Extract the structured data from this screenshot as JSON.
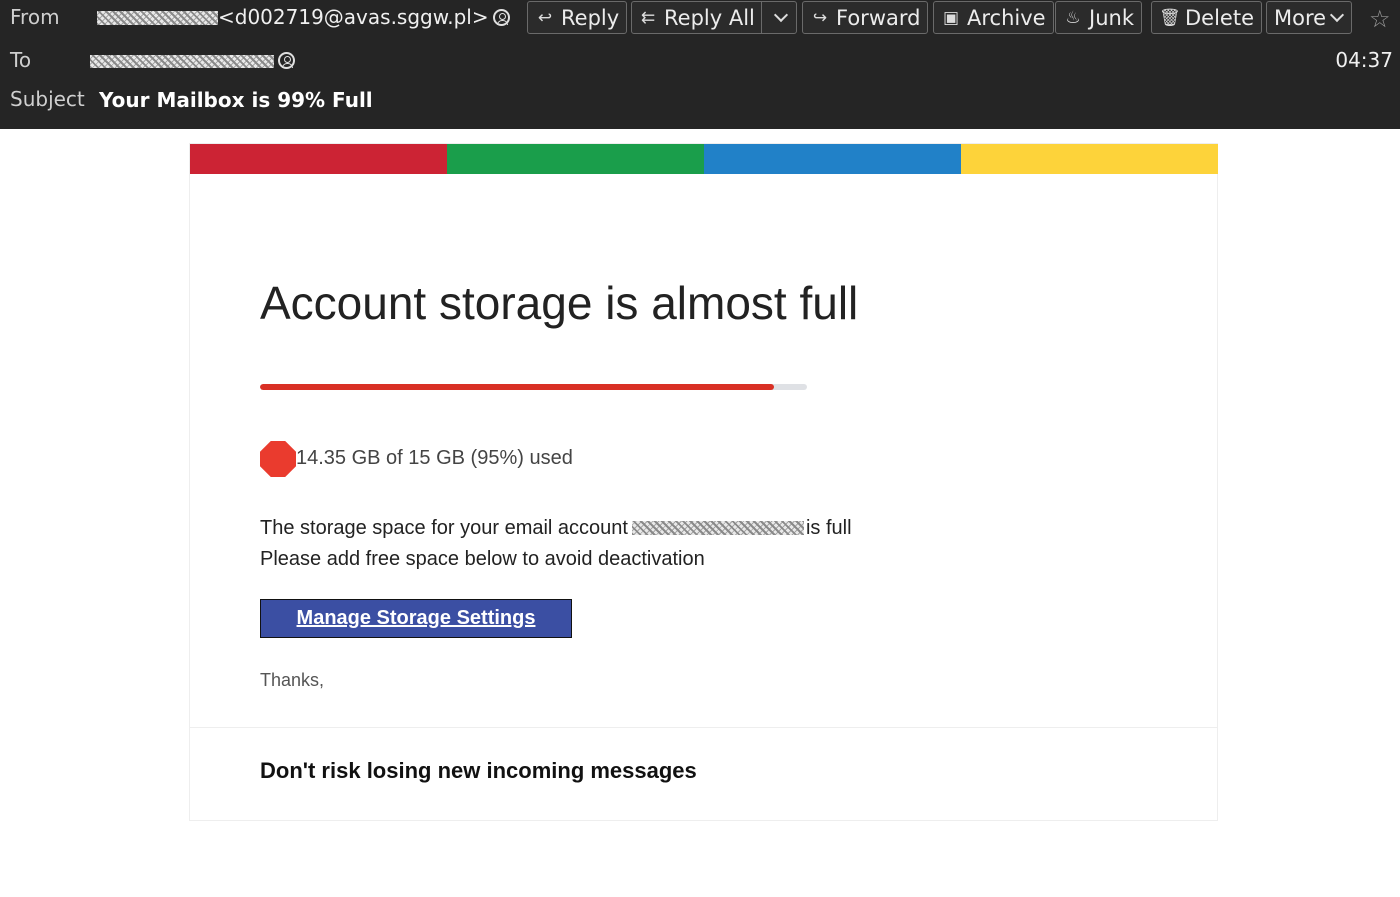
{
  "header": {
    "from_label": "From",
    "from_address": "<d002719@avas.sggw.pl>",
    "to_label": "To",
    "subject_label": "Subject",
    "subject": "Your Mailbox is 99% Full",
    "time": "04:37"
  },
  "toolbar": {
    "reply": "Reply",
    "reply_all": "Reply All",
    "forward": "Forward",
    "archive": "Archive",
    "junk": "Junk",
    "delete": "Delete",
    "more": "More"
  },
  "email": {
    "brand_colors": [
      "#cc2334",
      "#1a9e4b",
      "#2181c8",
      "#fdd33a"
    ],
    "title": "Account storage is almost full",
    "progress_percent": 94,
    "progress_color": "#d93025",
    "usage_text": "14.35 GB of 15 GB (95%) used",
    "line1_before": "The storage space for your email account",
    "line1_after": "is full",
    "line2": "Please add free space below to avoid deactivation",
    "button_label": "Manage Storage Settings",
    "button_color": "#3b4fa3",
    "thanks": "Thanks,",
    "footer_heading": "Don't risk losing new incoming messages"
  }
}
